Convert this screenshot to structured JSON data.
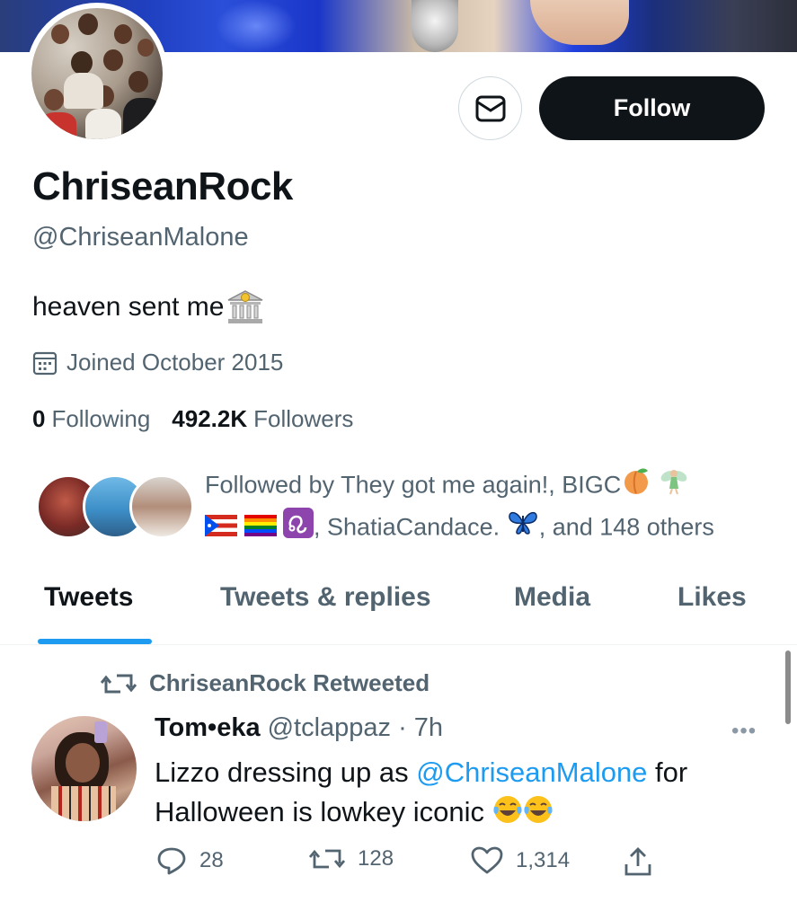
{
  "profile": {
    "display_name": "ChriseanRock",
    "handle": "@ChriseanMalone",
    "bio": "heaven sent me",
    "bio_emoji": "bank-emoji",
    "joined": "Joined October 2015",
    "following_count": "0",
    "following_label": "Following",
    "followers_count": "492.2K",
    "followers_label": "Followers"
  },
  "actions": {
    "follow_label": "Follow",
    "message_icon": "envelope-icon"
  },
  "followed_by": {
    "prefix": "Followed by They got me again!, BIGC",
    "middle": ", ShatiaCandace.",
    "suffix": ", and 148 others"
  },
  "tabs": [
    {
      "label": "Tweets",
      "active": true
    },
    {
      "label": "Tweets & replies",
      "active": false
    },
    {
      "label": "Media",
      "active": false
    },
    {
      "label": "Likes",
      "active": false
    }
  ],
  "tweet": {
    "retweet_label": "ChriseanRock Retweeted",
    "author_name": "Tom•eka",
    "author_handle": "@tclappaz",
    "separator": "·",
    "time": "7h",
    "body_start": "Lizzo dressing up as ",
    "mention": "@ChriseanMalone",
    "body_end": " for Halloween is lowkey iconic ",
    "replies": "28",
    "retweets": "128",
    "likes": "1,314"
  },
  "colors": {
    "accent": "#1d9bf0",
    "text": "#0f1419",
    "muted": "#536471",
    "follow_bg": "#0f1419"
  }
}
